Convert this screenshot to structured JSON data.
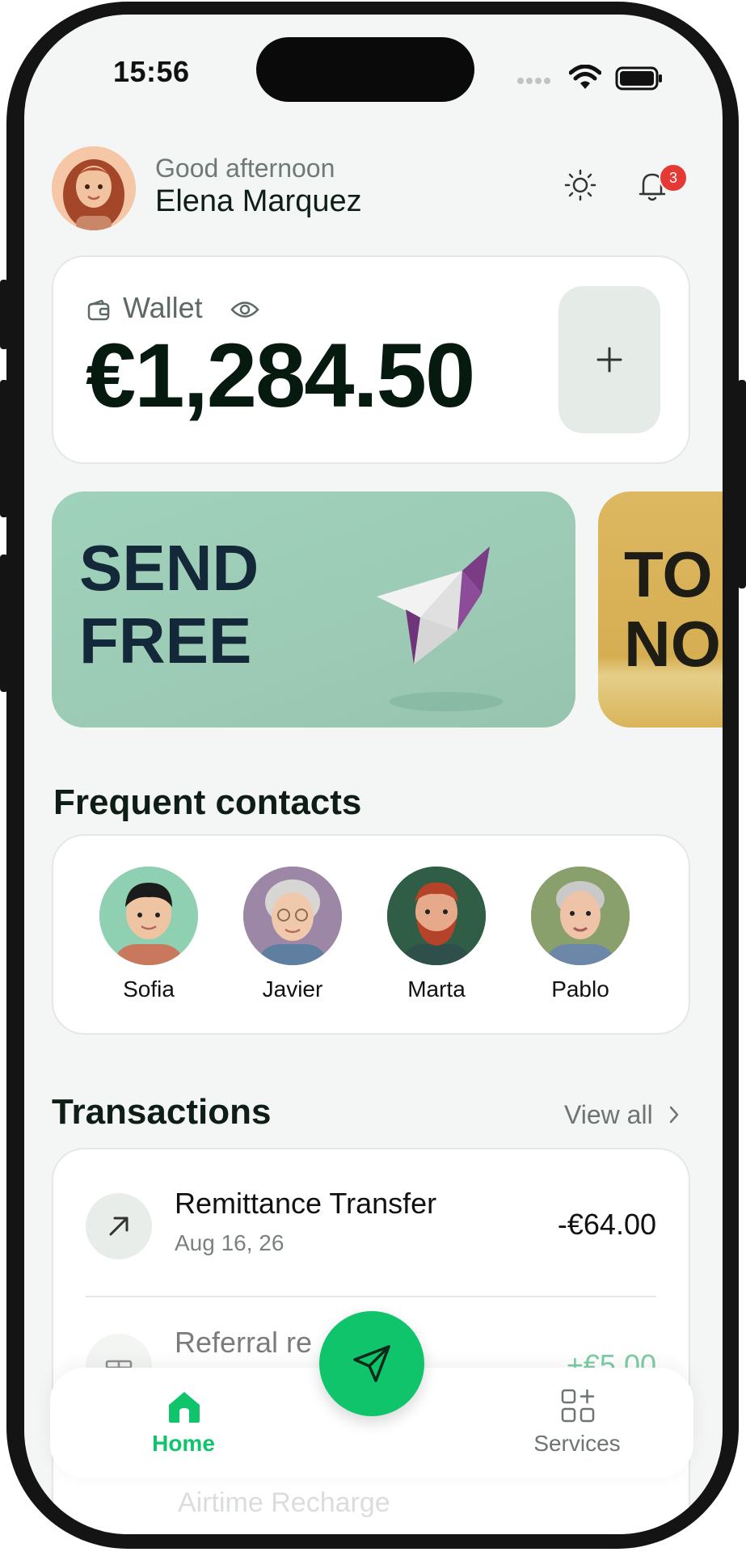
{
  "status_bar": {
    "time": "15:56"
  },
  "header": {
    "greeting": "Good afternoon",
    "user_name": "Elena Marquez",
    "notification_count": "3"
  },
  "wallet": {
    "label": "Wallet",
    "balance": "€1,284.50"
  },
  "banners": [
    {
      "line1": "SEND",
      "line2": "FREE"
    },
    {
      "line1": "TO",
      "line2": "NO"
    }
  ],
  "contacts": {
    "title": "Frequent contacts",
    "items": [
      {
        "name": "Sofia"
      },
      {
        "name": "Javier"
      },
      {
        "name": "Marta"
      },
      {
        "name": "Pablo"
      }
    ]
  },
  "transactions": {
    "title": "Transactions",
    "view_all": "View all",
    "items": [
      {
        "title": "Remittance Transfer",
        "date": "Aug 16, 26",
        "amount": "-€64.00"
      },
      {
        "title": "Referral re",
        "amount": "+€5.00"
      }
    ],
    "partial_third": "Airtime Recharge"
  },
  "nav": {
    "home_label": "Home",
    "services_label": "Services"
  },
  "colors": {
    "accent": "#10c46b",
    "badge": "#e53935",
    "background": "#f4f6f5",
    "text": "#0e1d16"
  }
}
